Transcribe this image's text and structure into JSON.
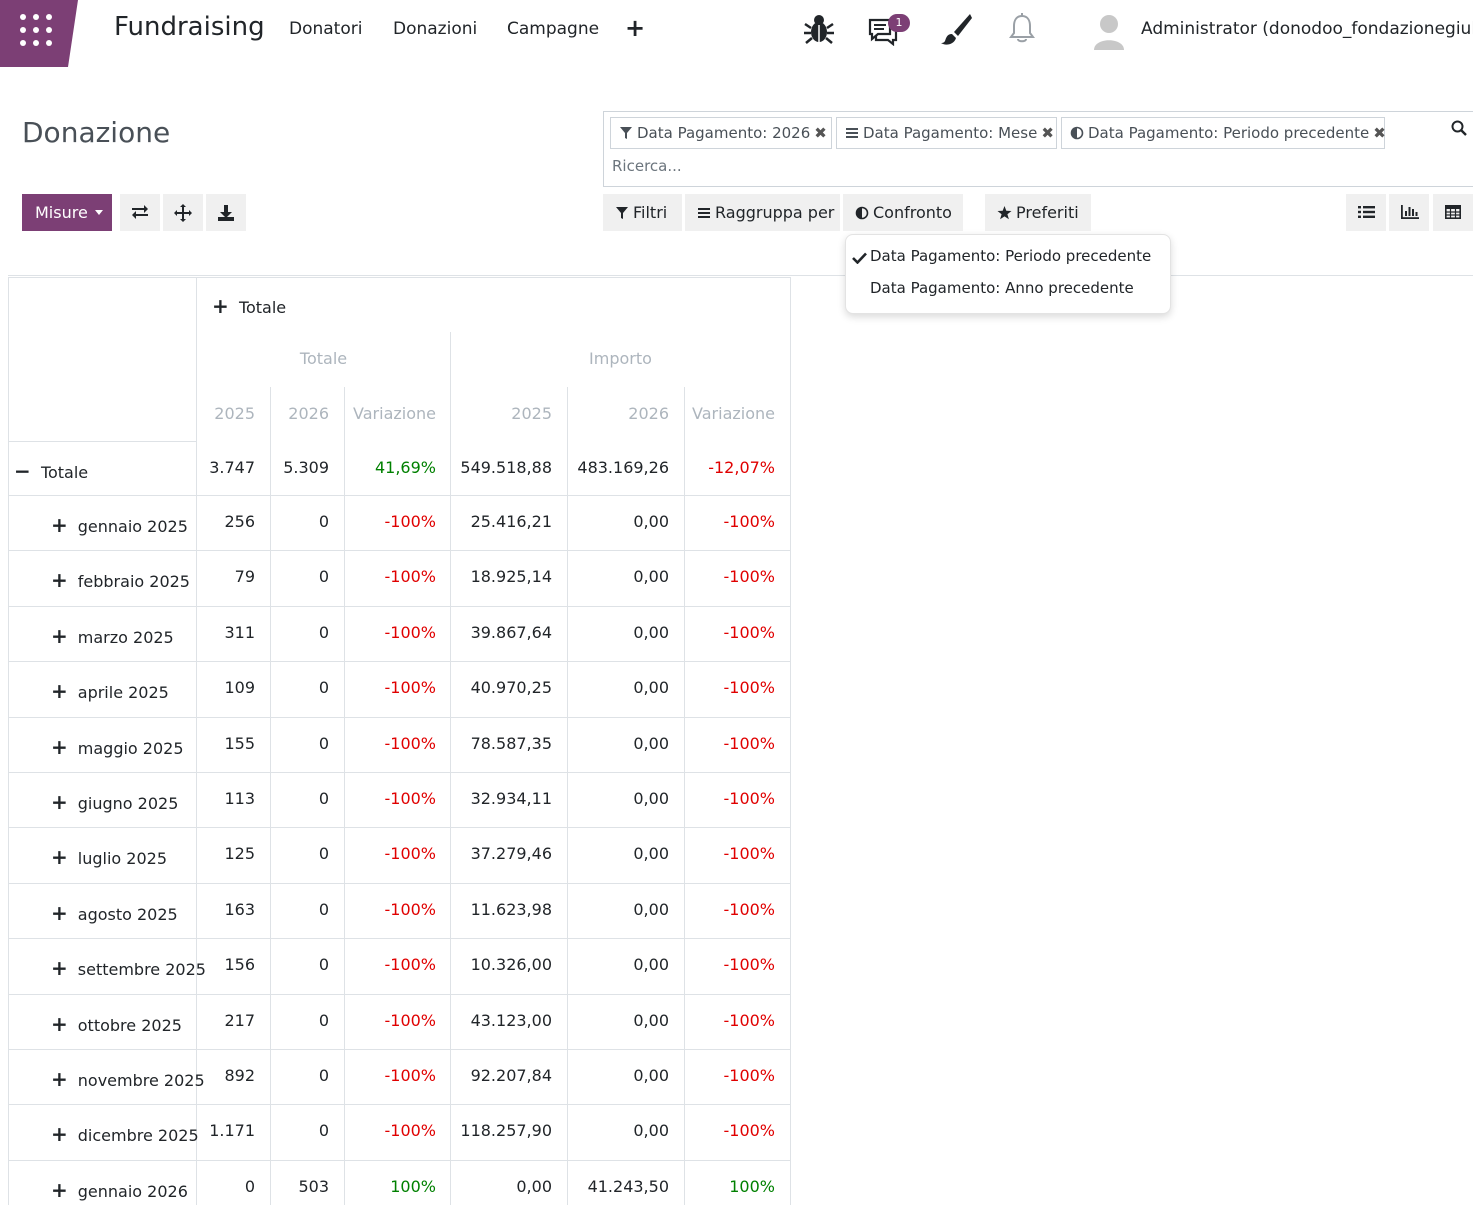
{
  "navbar": {
    "brand": "Fundraising",
    "menu": [
      "Donatori",
      "Donazioni",
      "Campagne"
    ],
    "add_symbol": "+",
    "messages_badge": "1",
    "user_name": "Administrator (donodoo_fondazionegiulia",
    "icons": [
      "apps-grid-icon",
      "bug-icon",
      "chat-icon",
      "brush-icon",
      "bell-icon",
      "avatar-icon"
    ]
  },
  "page": {
    "title": "Donazione"
  },
  "search": {
    "facets": [
      {
        "icon": "filter-icon",
        "label": "Data Pagamento: 2026"
      },
      {
        "icon": "groupby-icon",
        "label": "Data Pagamento: Mese"
      },
      {
        "icon": "compare-icon",
        "label": "Data Pagamento: Periodo precedente"
      }
    ],
    "remove_symbol": "✖",
    "placeholder": "Ricerca..."
  },
  "toolbar": {
    "measures_label": "Misure",
    "filters_label": "Filtri",
    "groupby_label": "Raggruppa per",
    "comparison_label": "Confronto",
    "favorites_label": "Preferiti"
  },
  "comparison_menu": {
    "items": [
      {
        "label": "Data Pagamento: Periodo precedente",
        "checked": true
      },
      {
        "label": "Data Pagamento: Anno precedente",
        "checked": false
      }
    ]
  },
  "pivot": {
    "col_header": "Totale",
    "measures": [
      "Totale",
      "Importo"
    ],
    "subheaders": [
      "2025",
      "2026",
      "Variazione",
      "2025",
      "2026",
      "Variazione"
    ],
    "total_row": {
      "label": "Totale",
      "values": [
        "3.747",
        "5.309",
        "41,69%",
        "549.518,88",
        "483.169,26",
        "-12,07%"
      ]
    },
    "rows": [
      {
        "label": "gennaio 2025",
        "values": [
          "256",
          "0",
          "-100%",
          "25.416,21",
          "0,00",
          "-100%"
        ]
      },
      {
        "label": "febbraio 2025",
        "values": [
          "79",
          "0",
          "-100%",
          "18.925,14",
          "0,00",
          "-100%"
        ]
      },
      {
        "label": "marzo 2025",
        "values": [
          "311",
          "0",
          "-100%",
          "39.867,64",
          "0,00",
          "-100%"
        ]
      },
      {
        "label": "aprile 2025",
        "values": [
          "109",
          "0",
          "-100%",
          "40.970,25",
          "0,00",
          "-100%"
        ]
      },
      {
        "label": "maggio 2025",
        "values": [
          "155",
          "0",
          "-100%",
          "78.587,35",
          "0,00",
          "-100%"
        ]
      },
      {
        "label": "giugno 2025",
        "values": [
          "113",
          "0",
          "-100%",
          "32.934,11",
          "0,00",
          "-100%"
        ]
      },
      {
        "label": "luglio 2025",
        "values": [
          "125",
          "0",
          "-100%",
          "37.279,46",
          "0,00",
          "-100%"
        ]
      },
      {
        "label": "agosto 2025",
        "values": [
          "163",
          "0",
          "-100%",
          "11.623,98",
          "0,00",
          "-100%"
        ]
      },
      {
        "label": "settembre 2025",
        "values": [
          "156",
          "0",
          "-100%",
          "10.326,00",
          "0,00",
          "-100%"
        ]
      },
      {
        "label": "ottobre 2025",
        "values": [
          "217",
          "0",
          "-100%",
          "43.123,00",
          "0,00",
          "-100%"
        ]
      },
      {
        "label": "novembre 2025",
        "values": [
          "892",
          "0",
          "-100%",
          "92.207,84",
          "0,00",
          "-100%"
        ]
      },
      {
        "label": "dicembre 2025",
        "values": [
          "1.171",
          "0",
          "-100%",
          "118.257,90",
          "0,00",
          "-100%"
        ]
      },
      {
        "label": "gennaio 2026",
        "values": [
          "0",
          "503",
          "100%",
          "0,00",
          "41.243,50",
          "100%"
        ]
      }
    ]
  },
  "colors": {
    "brand": "#7c3f75",
    "positive": "#008000",
    "negative": "#e00000"
  }
}
